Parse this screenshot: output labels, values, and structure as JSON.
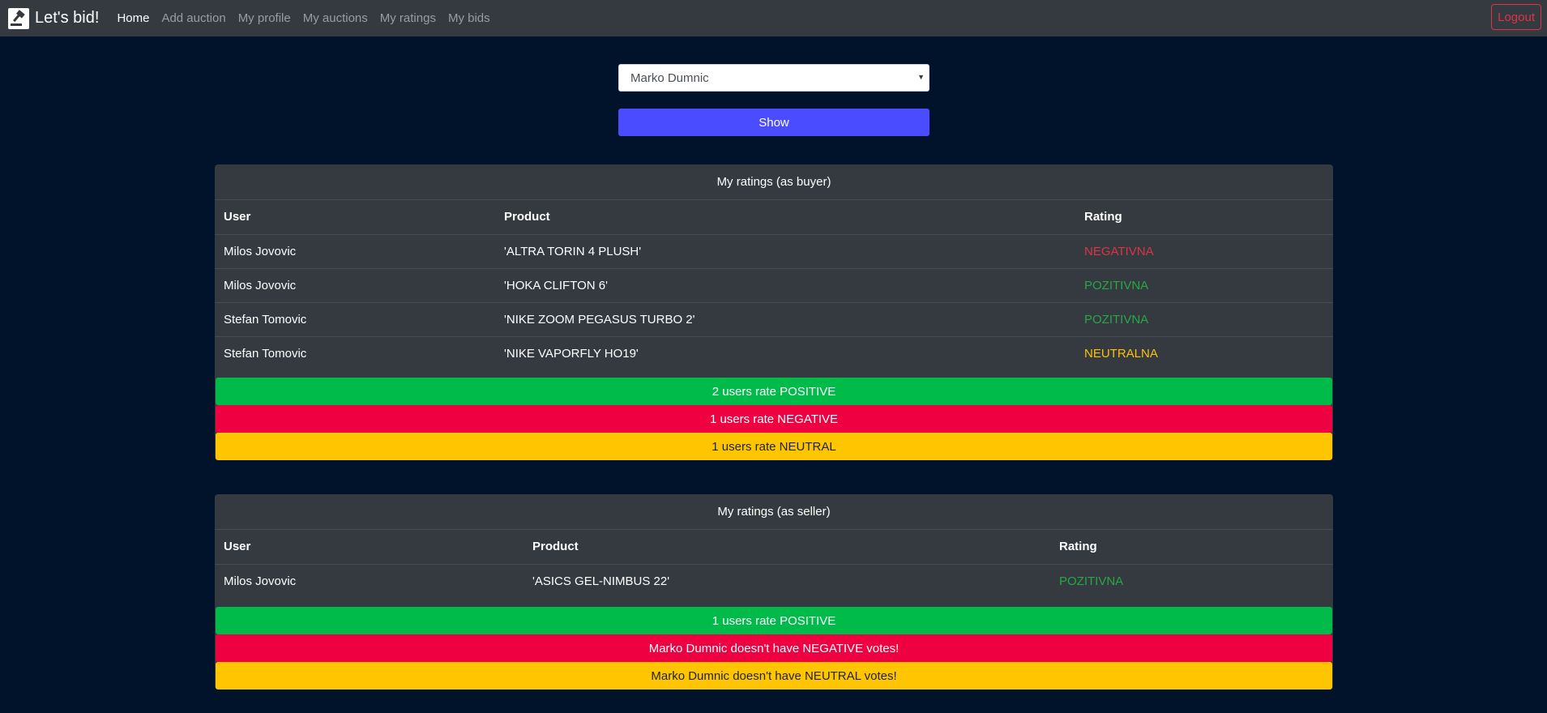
{
  "navbar": {
    "brand": "Let's bid!",
    "items": [
      "Home",
      "Add auction",
      "My profile",
      "My auctions",
      "My ratings",
      "My bids"
    ],
    "logout": "Logout"
  },
  "form": {
    "selected_user": "Marko Dumnic",
    "show_label": "Show"
  },
  "buyer": {
    "title": "My ratings (as buyer)",
    "columns": [
      "User",
      "Product",
      "Rating"
    ],
    "rows": [
      {
        "user": "Milos Jovovic",
        "product": "'ALTRA TORIN 4 PLUSH'",
        "rating": "NEGATIVNA"
      },
      {
        "user": "Milos Jovovic",
        "product": "'HOKA CLIFTON 6'",
        "rating": "POZITIVNA"
      },
      {
        "user": "Stefan Tomovic",
        "product": "'NIKE ZOOM PEGASUS TURBO 2'",
        "rating": "POZITIVNA"
      },
      {
        "user": "Stefan Tomovic",
        "product": "'NIKE VAPORFLY HO19'",
        "rating": "NEUTRALNA"
      }
    ],
    "summary": {
      "positive": "2 users rate POSITIVE",
      "negative": "1 users rate NEGATIVE",
      "neutral": "1 users rate NEUTRAL"
    }
  },
  "seller": {
    "title": "My ratings (as seller)",
    "columns": [
      "User",
      "Product",
      "Rating"
    ],
    "rows": [
      {
        "user": "Milos Jovovic",
        "product": "'ASICS GEL-NIMBUS 22'",
        "rating": "POZITIVNA"
      }
    ],
    "summary": {
      "positive": "1 users rate POSITIVE",
      "negative": "Marko Dumnic doesn't have NEGATIVE votes!",
      "neutral": "Marko Dumnic doesn't have NEUTRAL votes!"
    }
  },
  "colors": {
    "page_bg": "#00132b",
    "navbar_bg": "#343a40",
    "primary_button": "#4a4dff",
    "positive": "#00bb4a",
    "negative": "#ef0041",
    "neutral": "#ffc500"
  },
  "icons": {
    "brand": "gavel-icon",
    "select": "caret-down-icon"
  }
}
